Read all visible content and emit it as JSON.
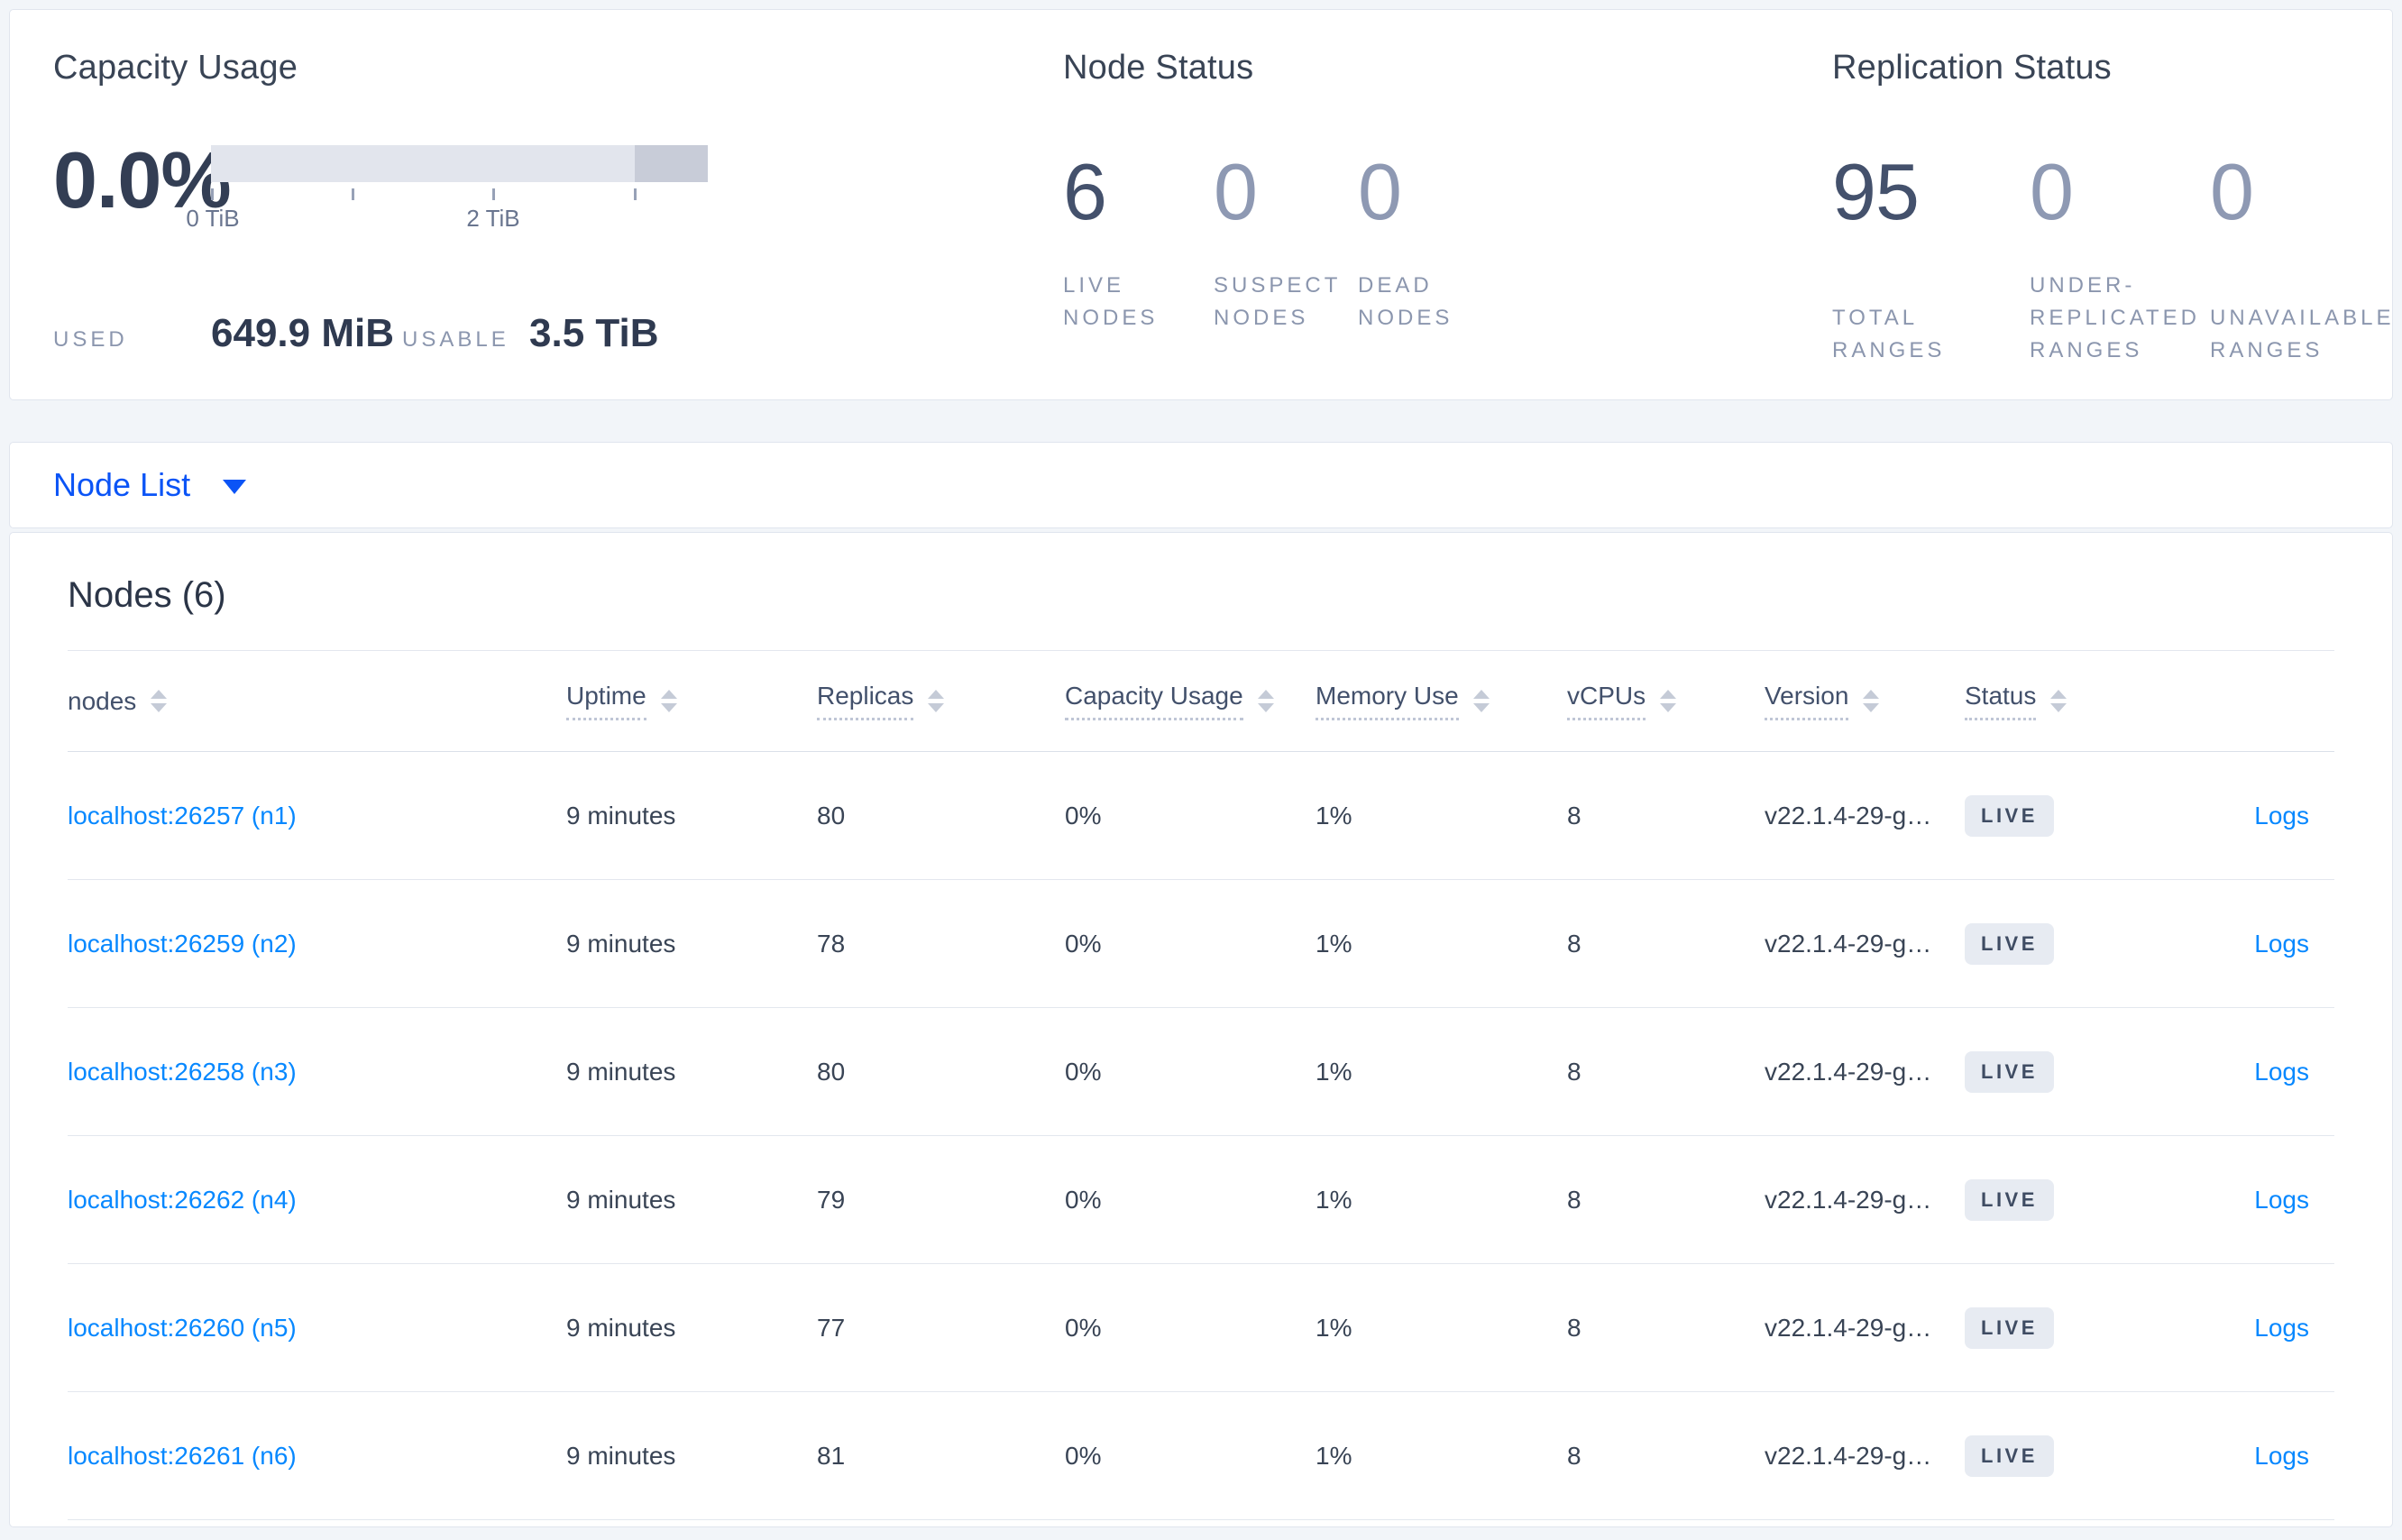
{
  "overview": {
    "capacity": {
      "title": "Capacity Usage",
      "percent": "0.0%",
      "axis_labels": [
        {
          "text": "0 TiB"
        },
        {
          "text": "2 TiB"
        }
      ],
      "used_label": "USED",
      "used_value": "649.9 MiB",
      "usable_label": "USABLE",
      "usable_value": "3.5 TiB"
    },
    "node_status": {
      "title": "Node Status",
      "stats": [
        {
          "value": "6",
          "label": "LIVE NODES"
        },
        {
          "value": "0",
          "label": "SUSPECT NODES"
        },
        {
          "value": "0",
          "label": "DEAD NODES"
        }
      ]
    },
    "replication": {
      "title": "Replication Status",
      "stats": [
        {
          "value": "95",
          "label": "TOTAL RANGES"
        },
        {
          "value": "0",
          "label": "UNDER-REPLICATED RANGES"
        },
        {
          "value": "0",
          "label": "UNAVAILABLE RANGES"
        }
      ]
    }
  },
  "view_selector": {
    "label": "Node List"
  },
  "nodes_table": {
    "title": "Nodes (6)",
    "columns": [
      {
        "label": "nodes"
      },
      {
        "label": "Uptime"
      },
      {
        "label": "Replicas"
      },
      {
        "label": "Capacity Usage"
      },
      {
        "label": "Memory Use"
      },
      {
        "label": "vCPUs"
      },
      {
        "label": "Version"
      },
      {
        "label": "Status"
      }
    ],
    "logs_label": "Logs",
    "rows": [
      {
        "address": "localhost:26257 (n1)",
        "uptime": "9 minutes",
        "replicas": "80",
        "capacity_usage": "0%",
        "memory_use": "1%",
        "vcpus": "8",
        "version": "v22.1.4-29-g…",
        "status": "LIVE"
      },
      {
        "address": "localhost:26259 (n2)",
        "uptime": "9 minutes",
        "replicas": "78",
        "capacity_usage": "0%",
        "memory_use": "1%",
        "vcpus": "8",
        "version": "v22.1.4-29-g…",
        "status": "LIVE"
      },
      {
        "address": "localhost:26258 (n3)",
        "uptime": "9 minutes",
        "replicas": "80",
        "capacity_usage": "0%",
        "memory_use": "1%",
        "vcpus": "8",
        "version": "v22.1.4-29-g…",
        "status": "LIVE"
      },
      {
        "address": "localhost:26262 (n4)",
        "uptime": "9 minutes",
        "replicas": "79",
        "capacity_usage": "0%",
        "memory_use": "1%",
        "vcpus": "8",
        "version": "v22.1.4-29-g…",
        "status": "LIVE"
      },
      {
        "address": "localhost:26260 (n5)",
        "uptime": "9 minutes",
        "replicas": "77",
        "capacity_usage": "0%",
        "memory_use": "1%",
        "vcpus": "8",
        "version": "v22.1.4-29-g…",
        "status": "LIVE"
      },
      {
        "address": "localhost:26261 (n6)",
        "uptime": "9 minutes",
        "replicas": "81",
        "capacity_usage": "0%",
        "memory_use": "1%",
        "vcpus": "8",
        "version": "v22.1.4-29-g…",
        "status": "LIVE"
      }
    ]
  },
  "colors": {
    "page_bg": "#f2f5f9",
    "card_border": "#e0e5ee",
    "link_primary": "#0b54f6",
    "link_table": "#0788ff",
    "bar_light": "#e2e5ed",
    "bar_dark": "#c8ccd8",
    "badge_bg": "#e7ebf2",
    "text_dark": "#394455",
    "text_muted": "#8b96ae"
  }
}
